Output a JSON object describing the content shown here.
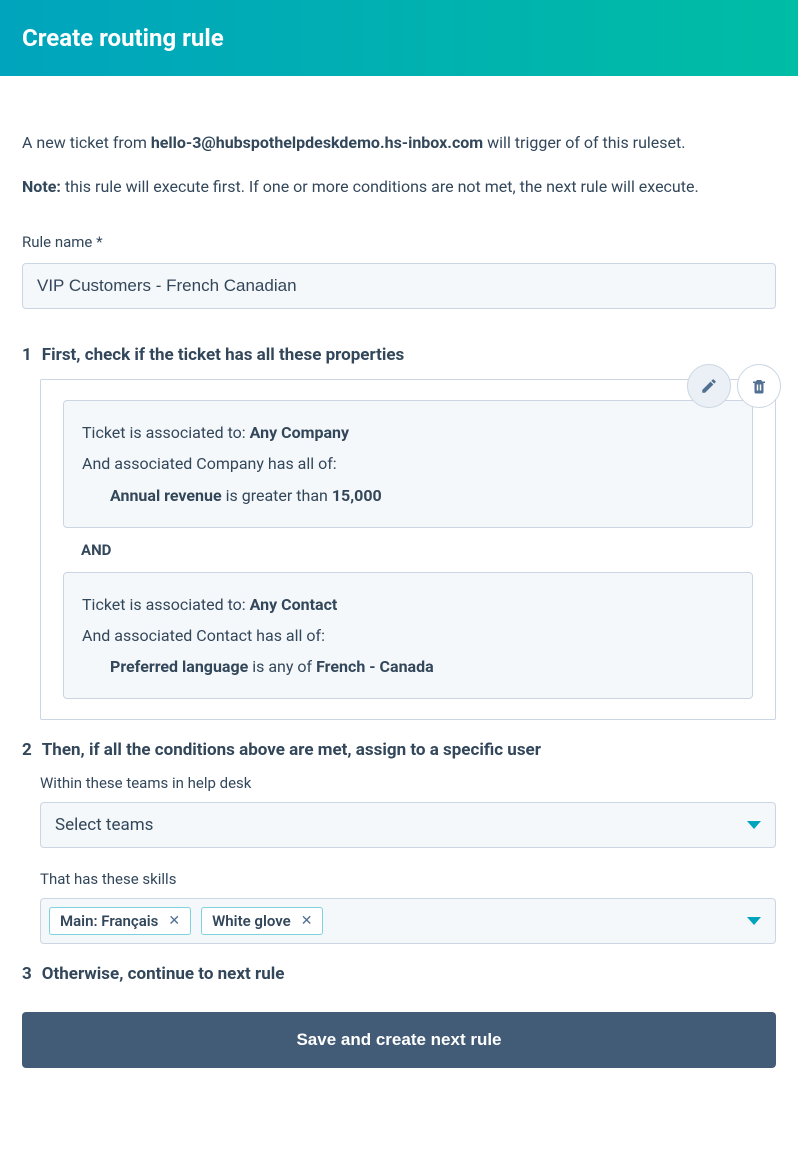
{
  "header": {
    "title": "Create routing rule"
  },
  "intro": {
    "prefix": "A new ticket from ",
    "email": "hello-3@hubspothelpdeskdemo.hs-inbox.com",
    "suffix": " will trigger of of this ruleset."
  },
  "note": {
    "label": "Note:",
    "text": " this rule will execute first. If one or more conditions are not met, the next rule will execute."
  },
  "rule_name": {
    "label": "Rule name *",
    "value": "VIP Customers - French Canadian"
  },
  "step1": {
    "number": "1",
    "title": "First, check if the ticket has all these properties",
    "conditions": [
      {
        "line1_prefix": "Ticket is associated to: ",
        "line1_bold": "Any Company",
        "line2": "And associated Company has all of:",
        "line3_bold1": "Annual revenue",
        "line3_mid": " is greater than ",
        "line3_bold2": "15,000"
      },
      {
        "line1_prefix": "Ticket is associated to: ",
        "line1_bold": "Any Contact",
        "line2": "And associated Contact has all of:",
        "line3_bold1": "Preferred language",
        "line3_mid": " is any of ",
        "line3_bold2": "French - Canada"
      }
    ],
    "and_label": "AND"
  },
  "step2": {
    "number": "2",
    "title": "Then, if all the conditions above are met, assign to a specific user",
    "teams_label": "Within these teams in help desk",
    "teams_placeholder": "Select teams",
    "skills_label": "That has these skills",
    "skills": [
      {
        "label": "Main: Français"
      },
      {
        "label": "White glove"
      }
    ]
  },
  "step3": {
    "number": "3",
    "title": "Otherwise, continue to next rule"
  },
  "save_button": "Save and create next rule"
}
